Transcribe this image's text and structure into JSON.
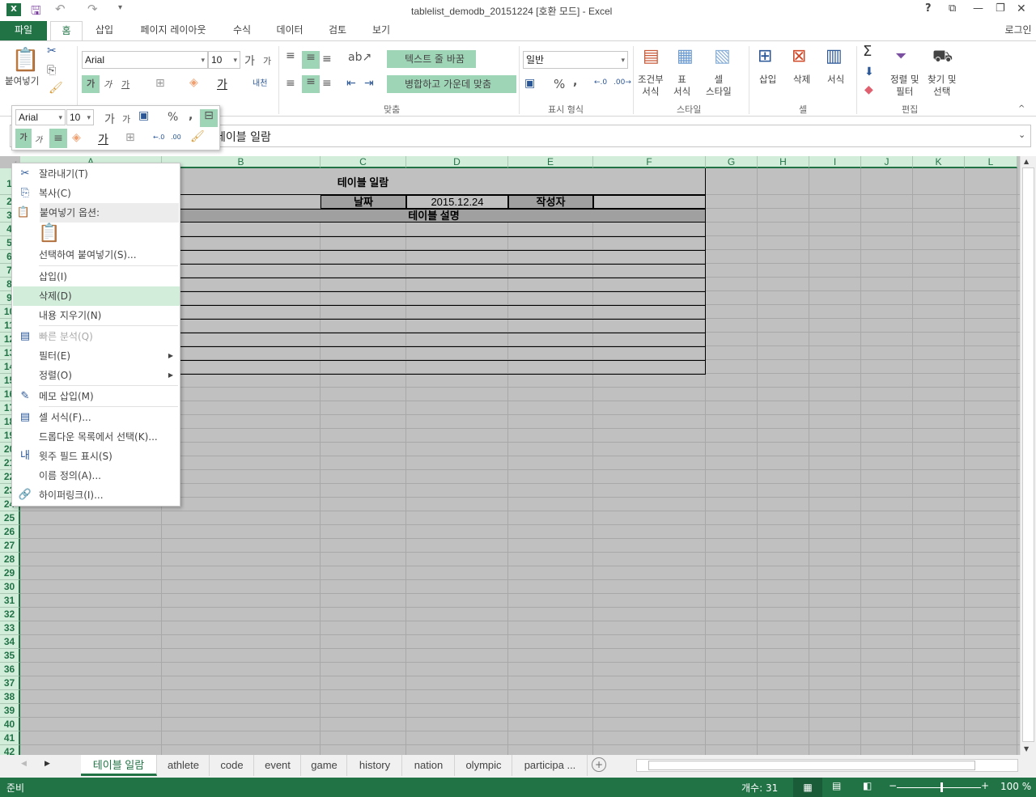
{
  "window": {
    "title": "tablelist_demodb_20151224  [호환 모드] - Excel",
    "login": "로그인",
    "controls": [
      "?",
      "⧉",
      "—",
      "❐",
      "✕"
    ]
  },
  "ribbon_tabs": [
    {
      "label": "파일"
    },
    {
      "label": "홈"
    },
    {
      "label": "삽입"
    },
    {
      "label": "페이지 레이아웃"
    },
    {
      "label": "수식"
    },
    {
      "label": "데이터"
    },
    {
      "label": "검토"
    },
    {
      "label": "보기"
    }
  ],
  "ribbon": {
    "clipboard": {
      "paste": "붙여넣기"
    },
    "font": {
      "name": "Arial",
      "size": "10"
    },
    "alignment": {
      "wrap_text": "텍스트 줄 바꿈",
      "merge_center": "병합하고 가운데 맞춤",
      "group": "맞춤"
    },
    "number": {
      "format": "일반",
      "group": "표시 형식"
    },
    "styles": {
      "conditional": [
        "조건부",
        "서식"
      ],
      "table": [
        "표",
        "서식"
      ],
      "cell_styles": [
        "셀",
        "스타일"
      ],
      "group": "스타일"
    },
    "cells": {
      "insert": "삽입",
      "delete": "삭제",
      "format": "서식",
      "group": "셀"
    },
    "editing": {
      "sort_filter": [
        "정렬 및",
        "필터"
      ],
      "find_select": [
        "찾기 및",
        "선택"
      ],
      "group": "편집"
    }
  },
  "mini_toolbar": {
    "font": "Arial",
    "size": "10"
  },
  "formula_bar": {
    "value": "테이블 일람"
  },
  "columns": [
    "A",
    "B",
    "C",
    "D",
    "E",
    "F",
    "G",
    "H",
    "I",
    "J",
    "K",
    "L"
  ],
  "cells": {
    "title": "테이블 일람",
    "date_label": "날짜",
    "date_value": "2015.12.24",
    "author_label": "작성자",
    "description_label": "테이블 설명"
  },
  "context_menu": [
    {
      "label": "잘라내기(T)",
      "icon": "scissors-icon"
    },
    {
      "label": "복사(C)",
      "icon": "copy-icon"
    },
    {
      "label": "붙여넣기 옵션:",
      "icon": "paste-icon",
      "header": true
    },
    {
      "label": "선택하여 붙여넣기(S)..."
    },
    {
      "label": "삽입(I)"
    },
    {
      "label": "삭제(D)",
      "hover": true
    },
    {
      "label": "내용 지우기(N)"
    },
    {
      "label": "빠른 분석(Q)",
      "disabled": true,
      "icon": "quick-analysis-icon"
    },
    {
      "label": "필터(E)",
      "submenu": true
    },
    {
      "label": "정렬(O)",
      "submenu": true
    },
    {
      "label": "메모 삽입(M)",
      "icon": "comment-icon"
    },
    {
      "label": "셀 서식(F)...",
      "icon": "format-cells-icon"
    },
    {
      "label": "드롭다운 목록에서 선택(K)..."
    },
    {
      "label": "윗주 필드 표시(S)",
      "icon": "phonetic-icon"
    },
    {
      "label": "이름 정의(A)..."
    },
    {
      "label": "하이퍼링크(I)...",
      "icon": "hyperlink-icon"
    }
  ],
  "sheet_tabs": [
    "테이블 일람",
    "athlete",
    "code",
    "event",
    "game",
    "history",
    "nation",
    "olympic",
    "participa ..."
  ],
  "status": {
    "ready": "준비",
    "count": "개수: 31",
    "zoom": "100 %",
    "zoom_level": 100
  },
  "colors": {
    "accent": "#217346",
    "selection": "#c0c0c0",
    "header_fill": "#a0a0a0"
  }
}
